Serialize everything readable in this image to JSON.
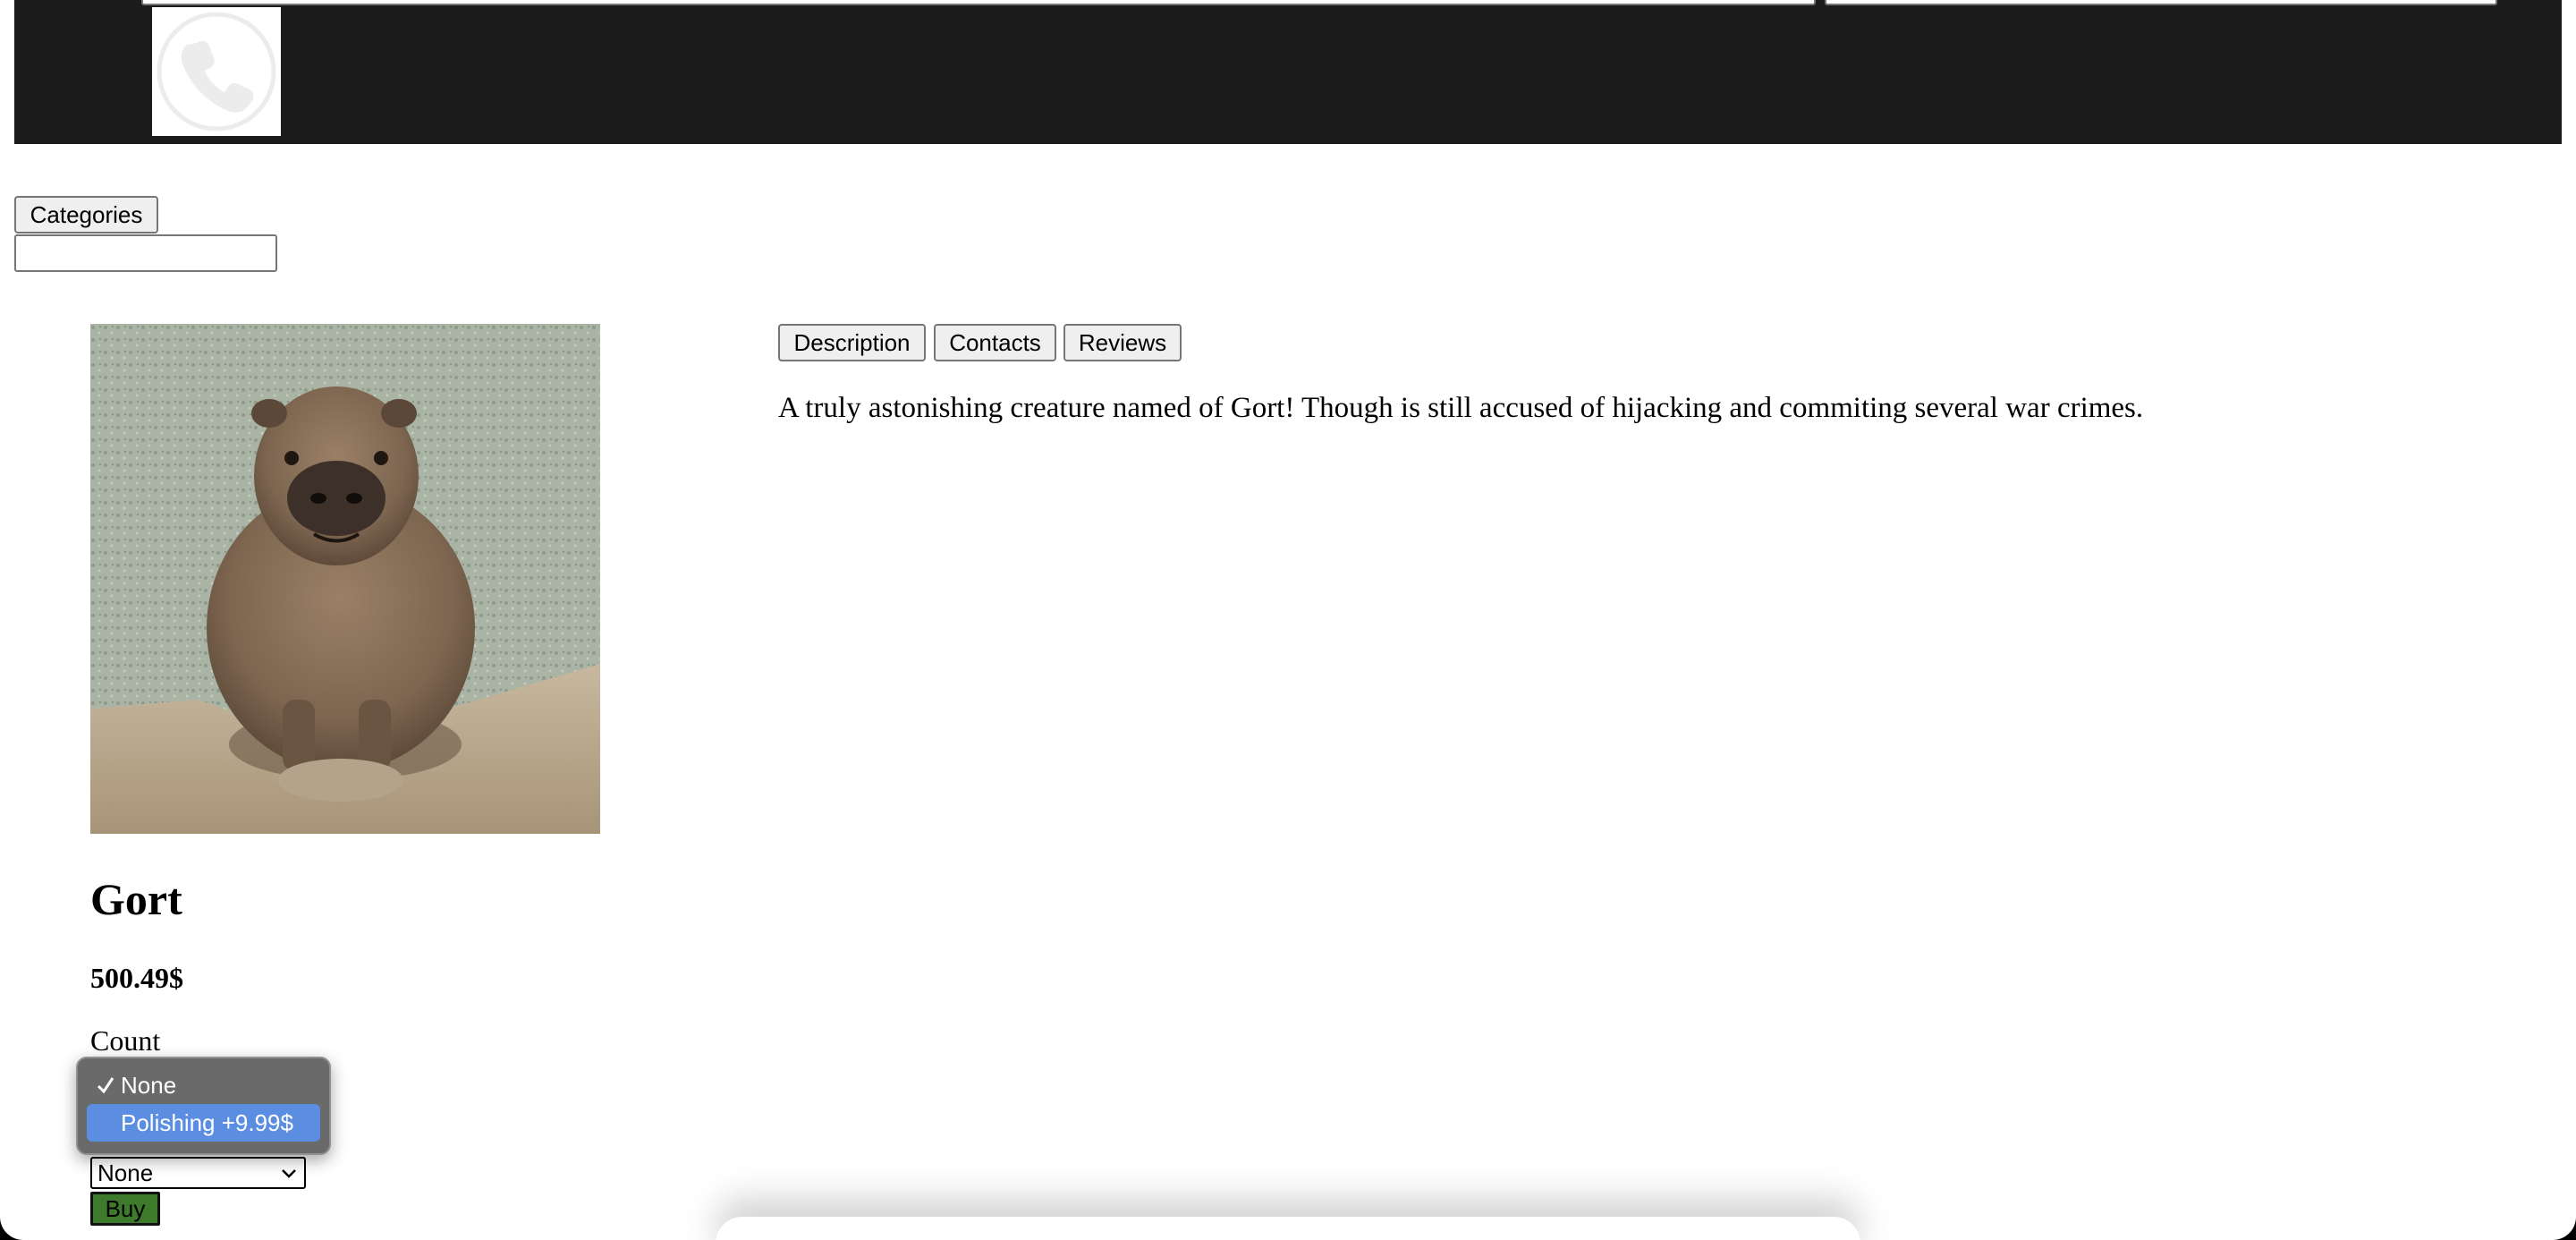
{
  "header": {
    "logo_icon": "phone-icon"
  },
  "nav": {
    "categories_label": "Categories",
    "search_value": ""
  },
  "product": {
    "image_desc_icon": "capybara-photo",
    "name": "Gort",
    "price": "500.49$",
    "count_label": "Count"
  },
  "tabs": [
    {
      "label": "Description"
    },
    {
      "label": "Contacts"
    },
    {
      "label": "Reviews"
    }
  ],
  "description_text": "A truly astonishing creature named of Gort! Though is still accused of hijacking and commiting several war crimes.",
  "options_select": {
    "selected": "None",
    "options": [
      "None",
      "Polishing +9.99$"
    ],
    "highlighted": "Polishing +9.99$"
  },
  "buy_label": "Buy",
  "colors": {
    "header_bg": "#1c1c1c",
    "buy_bg": "#3d7a2c",
    "highlight": "#5b8ee0"
  }
}
